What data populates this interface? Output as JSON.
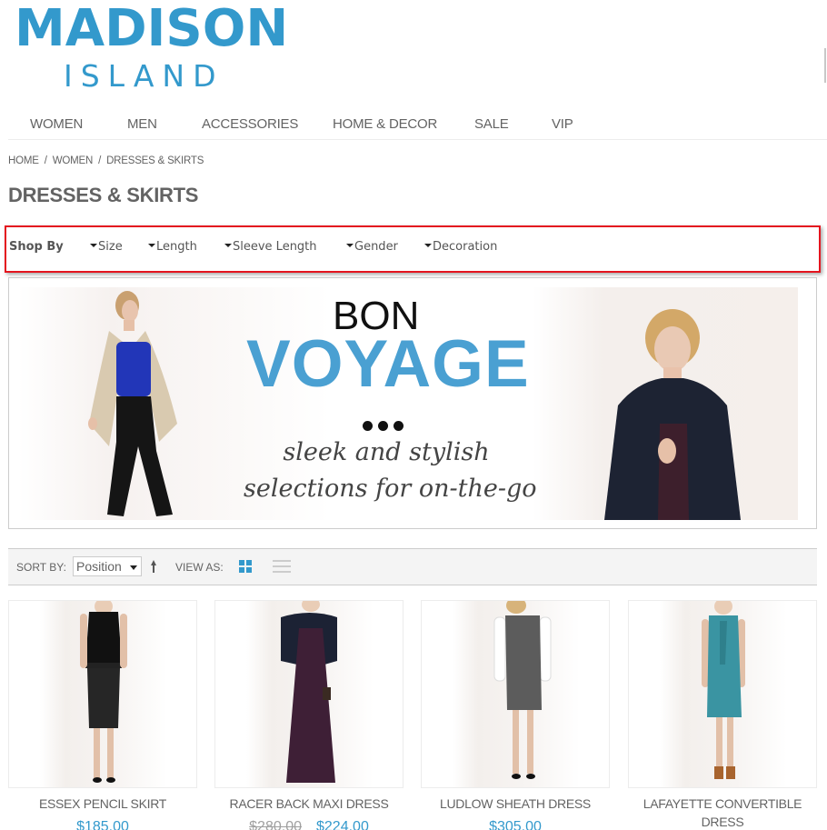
{
  "logo": {
    "main": "MADISON",
    "sub": "ISLAND",
    "color": "#3399cc"
  },
  "nav": [
    {
      "label": "WOMEN"
    },
    {
      "label": "MEN"
    },
    {
      "label": "ACCESSORIES"
    },
    {
      "label": "HOME & DECOR"
    },
    {
      "label": "SALE"
    },
    {
      "label": "VIP"
    }
  ],
  "breadcrumb": [
    {
      "label": "HOME"
    },
    {
      "label": "WOMEN"
    },
    {
      "label": "DRESSES & SKIRTS"
    }
  ],
  "breadcrumb_separator": "/",
  "page_title": "DRESSES & SKIRTS",
  "shop_by": {
    "label": "Shop By",
    "highlight_color": "#e4151f",
    "filters": [
      {
        "label": "Size"
      },
      {
        "label": "Length"
      },
      {
        "label": "Sleeve Length"
      },
      {
        "label": "Gender"
      },
      {
        "label": "Decoration"
      }
    ]
  },
  "banner": {
    "line1": "BON",
    "line2": "VOYAGE",
    "tagline1": "sleek and stylish",
    "tagline2": "selections for on-the-go",
    "accent_color": "#4aa0d2"
  },
  "toolbar": {
    "sort_label": "SORT BY:",
    "sort_value": "Position",
    "sort_direction_icon": "arrow-up-icon",
    "view_label": "VIEW AS:",
    "view_modes": [
      {
        "name": "grid",
        "active": true
      },
      {
        "name": "list",
        "active": false
      }
    ]
  },
  "products": [
    {
      "name": "ESSEX PENCIL SKIRT",
      "price": "$185.00",
      "old_price": null
    },
    {
      "name": "RACER BACK MAXI DRESS",
      "price": "$224.00",
      "old_price": "$280.00"
    },
    {
      "name": "LUDLOW SHEATH DRESS",
      "price": "$305.00",
      "old_price": null
    },
    {
      "name": "LAFAYETTE CONVERTIBLE DRESS",
      "price": null,
      "old_price": null
    }
  ]
}
